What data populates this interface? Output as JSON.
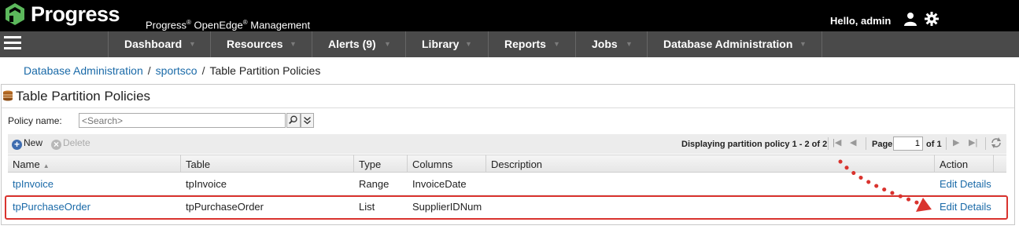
{
  "header": {
    "brand": "Progress",
    "subtitle_parts": [
      "Progress",
      "®",
      " OpenEdge",
      "®",
      " Management"
    ],
    "greeting": "Hello, admin",
    "icons": [
      "progress-logo",
      "user-icon",
      "gear-icon"
    ]
  },
  "nav": {
    "items": [
      {
        "label": "Dashboard"
      },
      {
        "label": "Resources"
      },
      {
        "label": "Alerts (9)"
      },
      {
        "label": "Library"
      },
      {
        "label": "Reports"
      },
      {
        "label": "Jobs"
      },
      {
        "label": "Database Administration"
      }
    ],
    "caret": "▼"
  },
  "breadcrumb": {
    "items": [
      "Database Administration",
      "sportsco",
      "Table Partition Policies"
    ],
    "separator": "/"
  },
  "panel": {
    "title": "Table Partition Policies",
    "filter_label": "Policy name:",
    "search_placeholder": "<Search>",
    "toolbar": {
      "new_label": "New",
      "delete_label": "Delete",
      "paging_text": "Displaying partition policy 1 - 2 of 2",
      "page_label": "Page",
      "page_value": "1",
      "of_label": "of 1"
    },
    "columns": [
      "Name",
      "Table",
      "Type",
      "Columns",
      "Description",
      "Action"
    ],
    "rows": [
      {
        "name": "tpInvoice",
        "table": "tpInvoice",
        "type": "Range",
        "columns": "InvoiceDate",
        "description": "",
        "action": "Edit Details"
      },
      {
        "name": "tpPurchaseOrder",
        "table": "tpPurchaseOrder",
        "type": "List",
        "columns": "SupplierIDNum",
        "description": "",
        "action": "Edit Details"
      }
    ]
  },
  "colors": {
    "link": "#1a6aa8",
    "logo_green": "#5cb85c",
    "nav_bg": "#4a4a4a",
    "highlight": "#d9332e",
    "new_icon": "#3f6db0",
    "delete_icon": "#b8b8b8"
  }
}
